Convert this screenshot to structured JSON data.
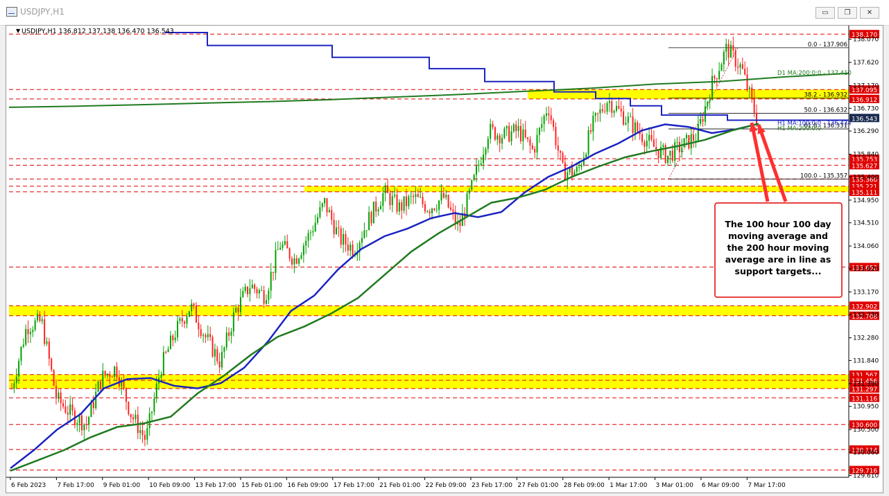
{
  "window": {
    "title": "USDJPY,H1",
    "minimize": "▭",
    "restore": "❐",
    "close": "✕"
  },
  "chart_header": "USDJPY,H1  136.812 137.138 136.470 136.543",
  "colors": {
    "bullish": "#00a000",
    "bearish": "#ff2020",
    "ma100": "#1a23c0",
    "ma200": "#1f7a1f",
    "highlight": "#ffff00",
    "level_line": "#e00000",
    "price_box_bg": "#e00000",
    "current_price_bg": "#1a2a50",
    "arrow": "#ff3030"
  },
  "chart_data": {
    "type": "candlestick",
    "symbol": "USDJPY",
    "timeframe": "H1",
    "ohlc": {
      "open": 136.812,
      "high": 137.138,
      "low": 136.47,
      "close": 136.543
    },
    "ylim": [
      129.575,
      138.28
    ],
    "y_ticks": [
      "138.070",
      "137.620",
      "137.170",
      "136.730",
      "136.290",
      "135.840",
      "135.400",
      "134.950",
      "134.510",
      "134.060",
      "133.620",
      "133.170",
      "132.730",
      "132.280",
      "131.840",
      "131.390",
      "130.950",
      "130.500",
      "130.060",
      "129.610"
    ],
    "x_ticks": [
      "6 Feb 2023",
      "7 Feb 17:00",
      "9 Feb 01:00",
      "10 Feb 09:00",
      "13 Feb 17:00",
      "15 Feb 01:00",
      "16 Feb 09:00",
      "17 Feb 17:00",
      "21 Feb 01:00",
      "22 Feb 09:00",
      "23 Feb 17:00",
      "27 Feb 01:00",
      "28 Feb 09:00",
      "1 Mar 17:00",
      "3 Mar 01:00",
      "6 Mar 09:00",
      "7 Mar 17:00"
    ],
    "price_levels": [
      {
        "label": "138.170",
        "value": 138.17
      },
      {
        "label": "137.095",
        "value": 137.095
      },
      {
        "label": "136.912",
        "value": 136.912
      },
      {
        "label": "135.753",
        "value": 135.753
      },
      {
        "label": "135.627",
        "value": 135.627
      },
      {
        "label": "135.360",
        "value": 135.36
      },
      {
        "label": "135.221",
        "value": 135.221
      },
      {
        "label": "135.111",
        "value": 135.111
      },
      {
        "label": "133.652",
        "value": 133.652
      },
      {
        "label": "132.902",
        "value": 132.902
      },
      {
        "label": "132.708",
        "value": 132.708
      },
      {
        "label": "131.567",
        "value": 131.567
      },
      {
        "label": "131.456",
        "value": 131.456
      },
      {
        "label": "131.297",
        "value": 131.297
      },
      {
        "label": "131.116",
        "value": 131.116
      },
      {
        "label": "130.600",
        "value": 130.6
      },
      {
        "label": "130.114",
        "value": 130.114
      },
      {
        "label": "129.716",
        "value": 129.716
      }
    ],
    "current_price": {
      "label": "136.543",
      "value": 136.543
    },
    "highlight_zones": [
      {
        "from": 136.912,
        "to": 137.095
      },
      {
        "from": 135.111,
        "to": 135.221
      },
      {
        "from": 132.708,
        "to": 132.902
      },
      {
        "from": 131.297,
        "to": 131.567
      }
    ],
    "fibonacci": [
      {
        "label": "0.0 - 137.906",
        "value": 137.906
      },
      {
        "label": "38.2 - 136.932",
        "value": 136.932
      },
      {
        "label": "50.0 - 136.632",
        "value": 136.632
      },
      {
        "label": "61.8 - 136.331",
        "value": 136.331
      },
      {
        "label": "100.0 - 135.357",
        "value": 135.357
      }
    ],
    "indicators": [
      {
        "label": "D1 MA:200:0:0 - 137.410",
        "value": 137.41
      },
      {
        "label": "H1 MA:100:0:0 - 136.434",
        "value": 136.434
      },
      {
        "label": "H1 MA:200:0:0",
        "value": 136.35
      }
    ],
    "ma100_series": [
      129.75,
      130.1,
      130.5,
      130.8,
      131.3,
      131.48,
      131.5,
      131.35,
      131.3,
      131.4,
      131.7,
      132.2,
      132.8,
      133.1,
      133.6,
      134.0,
      134.25,
      134.4,
      134.6,
      134.7,
      134.62,
      134.72,
      135.1,
      135.4,
      135.6,
      135.85,
      136.05,
      136.3,
      136.42,
      136.37,
      136.25,
      136.32,
      136.43
    ],
    "ma200_series": [
      129.7,
      129.9,
      130.1,
      130.35,
      130.55,
      130.62,
      130.75,
      131.2,
      131.55,
      131.95,
      132.3,
      132.5,
      132.75,
      133.05,
      133.5,
      133.95,
      134.3,
      134.6,
      134.9,
      135.0,
      135.15,
      135.4,
      135.6,
      135.78,
      135.9,
      136.0,
      136.12,
      136.3,
      136.43
    ],
    "d1_ma200_series": [
      136.75,
      136.77,
      136.8,
      136.83,
      136.86,
      136.9,
      136.95,
      137.0,
      137.06,
      137.12,
      137.2,
      137.25,
      137.34,
      137.41
    ],
    "close_series": [
      131.3,
      132.5,
      132.6,
      131.1,
      130.8,
      130.6,
      131.5,
      131.7,
      130.8,
      130.3,
      131.7,
      132.4,
      132.9,
      132.3,
      131.8,
      132.8,
      133.3,
      133.1,
      134.1,
      133.8,
      134.3,
      134.9,
      134.2,
      134.0,
      134.6,
      135.1,
      134.8,
      135.0,
      134.8,
      135.0,
      134.4,
      135.3,
      136.3,
      136.2,
      136.3,
      135.9,
      136.8,
      135.5,
      135.5,
      136.4,
      136.9,
      136.6,
      136.3,
      136.0,
      135.8,
      136.0,
      136.2,
      137.2,
      137.9,
      137.5,
      136.54
    ],
    "annotation": "The 100 hour 100 day moving average and the 200 hour moving average are in line as support targets..."
  }
}
